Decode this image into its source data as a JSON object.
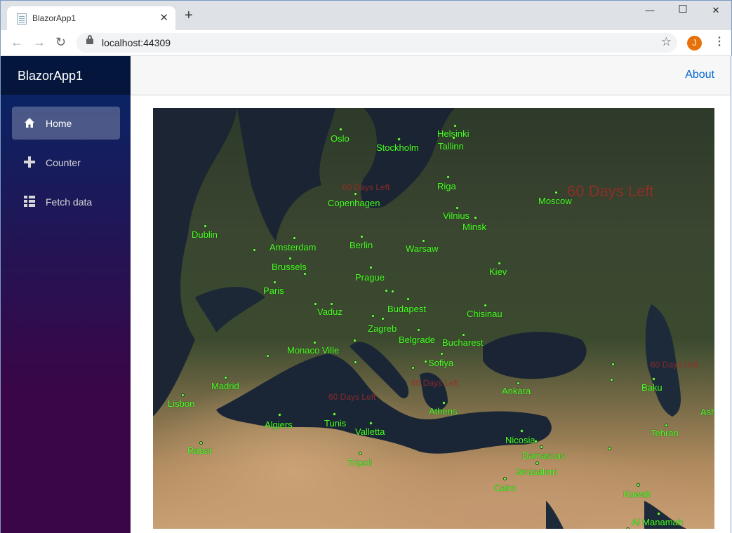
{
  "browser": {
    "tab_title": "BlazorApp1",
    "new_tab": "+",
    "close": "✕",
    "minimize": "—",
    "maximize": "☐",
    "window_close": "✕",
    "url": "localhost:44309",
    "profile_initial": "J"
  },
  "app": {
    "brand": "BlazorApp1",
    "nav": [
      {
        "label": "Home",
        "active": true
      },
      {
        "label": "Counter",
        "active": false
      },
      {
        "label": "Fetch data",
        "active": false
      }
    ],
    "about": "About"
  },
  "map": {
    "cities": [
      "Oslo",
      "Stockholm",
      "Helsinki",
      "Tallinn",
      "Riga",
      "Copenhagen",
      "Moscow",
      "Vilnius",
      "Minsk",
      "Dublin",
      "Amsterdam",
      "Berlin",
      "Warsaw",
      "Brussels",
      "Prague",
      "Kiev",
      "Paris",
      "Budapest",
      "Vaduz",
      "Chisinau",
      "Zagreb",
      "Belgrade",
      "Bucharest",
      "Monaco Ville",
      "Sofiya",
      "Madrid",
      "Ankara",
      "Baku",
      "Lisbon",
      "Athens",
      "Algiers",
      "Tunis",
      "Valletta",
      "Tehran",
      "Rabat",
      "Nicosia",
      "Damascus",
      "Jerusalem",
      "Tripoli",
      "Cairo",
      "Kuwait",
      "Al Manamah",
      "Ash"
    ],
    "countdowns": [
      "60 Days Left",
      "60 Days Left",
      "60 Days Left",
      "60 Days Left",
      "60 Days Left"
    ]
  }
}
